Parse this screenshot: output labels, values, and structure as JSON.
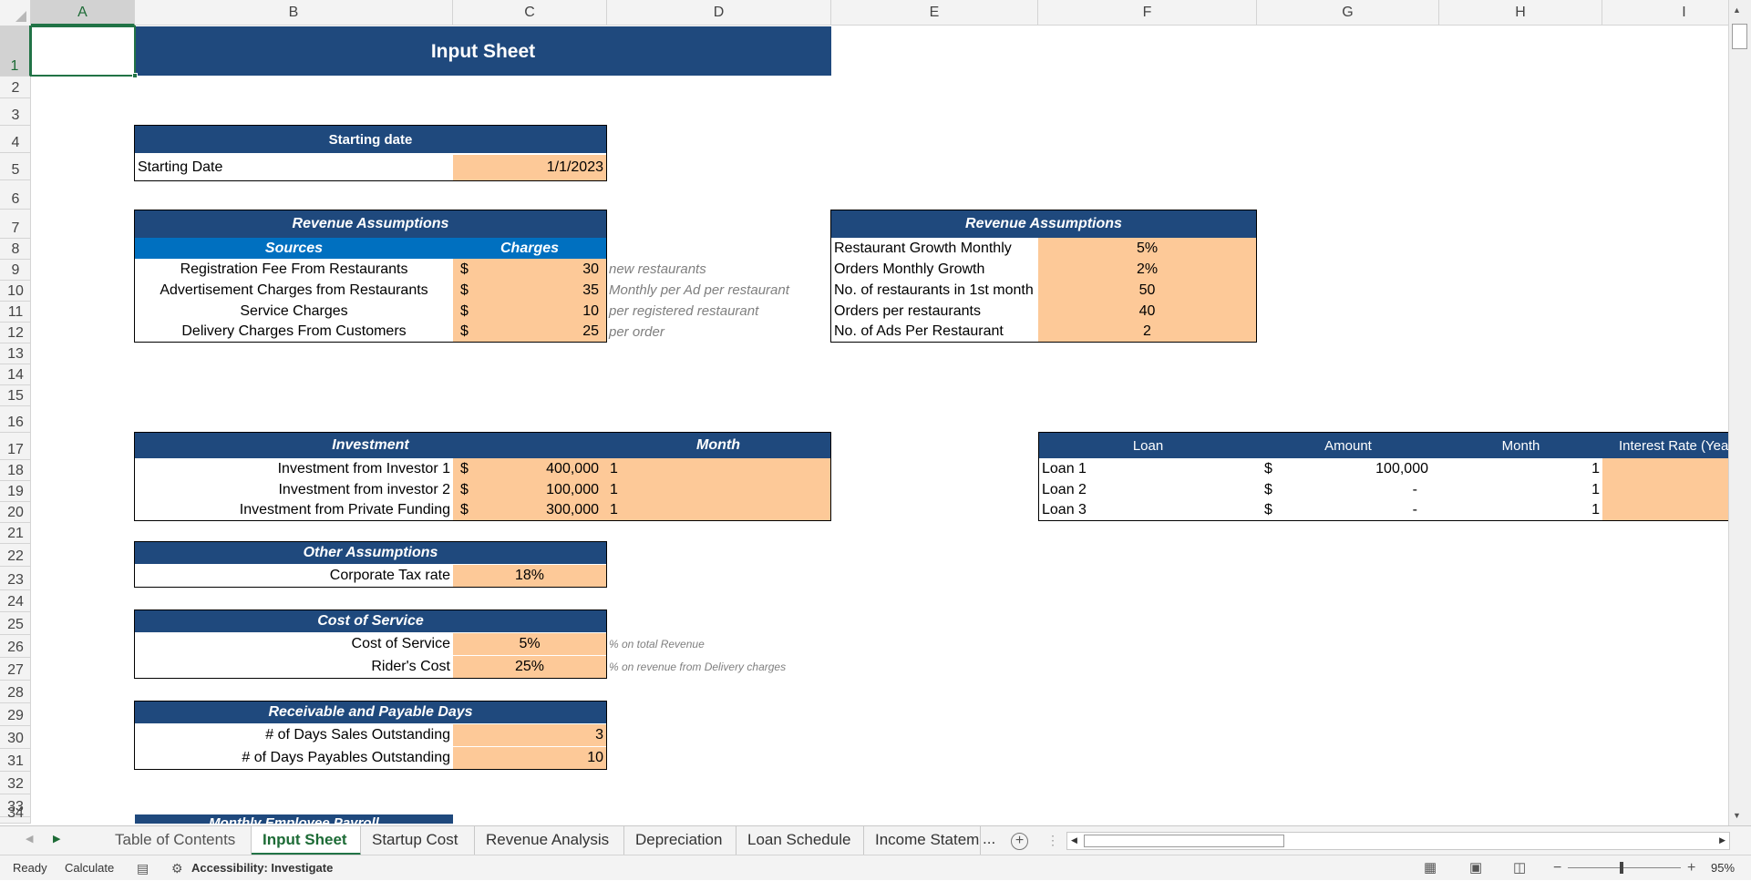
{
  "columns": [
    "A",
    "B",
    "C",
    "D",
    "E",
    "F",
    "G",
    "H",
    "I"
  ],
  "rows": [
    "1",
    "2",
    "3",
    "4",
    "5",
    "6",
    "7",
    "8",
    "9",
    "10",
    "11",
    "12",
    "13",
    "14",
    "15",
    "16",
    "17",
    "18",
    "19",
    "20",
    "21",
    "22",
    "23",
    "24",
    "25",
    "26",
    "27",
    "28",
    "29",
    "30",
    "31",
    "32",
    "33",
    "34"
  ],
  "sheet_title": "Input Sheet",
  "starting": {
    "header": "Starting date",
    "label": "Starting Date",
    "value": "1/1/2023"
  },
  "revenue": {
    "header": "Revenue Assumptions",
    "col_sources": "Sources",
    "col_charges": "Charges",
    "items": [
      {
        "label": "Registration Fee From Restaurants",
        "cur": "$",
        "value": "30",
        "note": "new restaurants"
      },
      {
        "label": "Advertisement Charges from Restaurants",
        "cur": "$",
        "value": "35",
        "note": "Monthly per Ad per restaurant"
      },
      {
        "label": "Service Charges",
        "cur": "$",
        "value": "10",
        "note": "per registered restaurant"
      },
      {
        "label": "Delivery Charges From Customers",
        "cur": "$",
        "value": "25",
        "note": "per order"
      }
    ]
  },
  "revenue2": {
    "header": "Revenue Assumptions",
    "items": [
      {
        "label": "Restaurant Growth Monthly",
        "value": "5%"
      },
      {
        "label": "Orders Monthly Growth",
        "value": "2%"
      },
      {
        "label": "No. of restaurants in 1st month",
        "value": "50"
      },
      {
        "label": "Orders per restaurants",
        "value": "40"
      },
      {
        "label": "No. of Ads Per Restaurant",
        "value": "2"
      }
    ]
  },
  "investment": {
    "header": "Investment",
    "month_header": "Month",
    "items": [
      {
        "label": "Investment from Investor 1",
        "cur": "$",
        "value": "400,000",
        "month": "1"
      },
      {
        "label": "Investment from investor 2",
        "cur": "$",
        "value": "100,000",
        "month": "1"
      },
      {
        "label": "Investment from Private Funding",
        "cur": "$",
        "value": "300,000",
        "month": "1"
      }
    ]
  },
  "loan": {
    "headers": [
      "Loan",
      "Amount",
      "Month",
      "Interest Rate (Yea"
    ],
    "items": [
      {
        "label": "Loan 1",
        "cur": "$",
        "value": "100,000",
        "month": "1"
      },
      {
        "label": "Loan 2",
        "cur": "$",
        "value": "-",
        "month": "1"
      },
      {
        "label": "Loan 3",
        "cur": "$",
        "value": "-",
        "month": "1"
      }
    ]
  },
  "other": {
    "header": "Other Assumptions",
    "label": "Corporate Tax rate",
    "value": "18%"
  },
  "cost": {
    "header": "Cost of Service",
    "items": [
      {
        "label": "Cost of Service",
        "value": "5%",
        "note": "% on total Revenue"
      },
      {
        "label": "Rider's Cost",
        "value": "25%",
        "note": "% on revenue from Delivery charges"
      }
    ]
  },
  "days": {
    "header": "Receivable and Payable Days",
    "items": [
      {
        "label": "# of Days Sales Outstanding",
        "value": "3"
      },
      {
        "label": "# of Days Payables Outstanding",
        "value": "10"
      }
    ]
  },
  "payroll_header": "Monthly Employee Payroll",
  "tabs": [
    "Table of Contents",
    "Input Sheet",
    "Startup Cost",
    "Revenue Analysis",
    "Depreciation",
    "Loan Schedule",
    "Income Statem"
  ],
  "tabs_more": "...",
  "status": {
    "ready": "Ready",
    "calculate": "Calculate",
    "accessibility": "Accessibility: Investigate",
    "zoom": "95%"
  },
  "colors": {
    "navy": "#1f497d",
    "blue": "#0070c0",
    "peach": "#fdc998",
    "excel_green": "#217346"
  }
}
